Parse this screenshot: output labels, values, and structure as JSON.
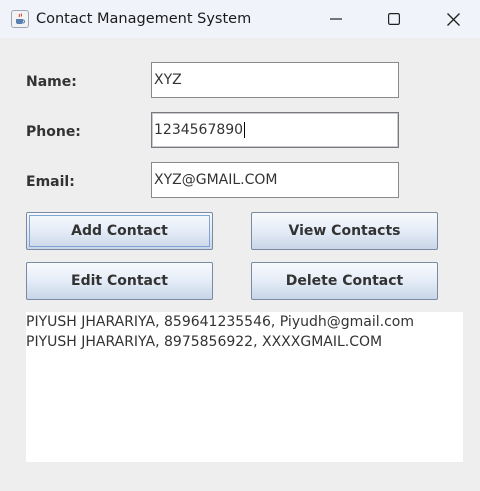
{
  "window": {
    "title": "Contact Management System",
    "icon": "java-cup-icon"
  },
  "form": {
    "name_label": "Name:",
    "name_value": "XYZ",
    "phone_label": "Phone:",
    "phone_value": "1234567890",
    "email_label": "Email:",
    "email_value": "XYZ@GMAIL.COM"
  },
  "buttons": {
    "add": "Add Contact",
    "view": "View Contacts",
    "edit": "Edit Contact",
    "delete": "Delete Contact"
  },
  "contacts": [
    "PIYUSH JHARARIYA, 859641235546, Piyudh@gmail.com",
    "PIYUSH JHARARIYA, 8975856922, XXXXGMAIL.COM"
  ]
}
